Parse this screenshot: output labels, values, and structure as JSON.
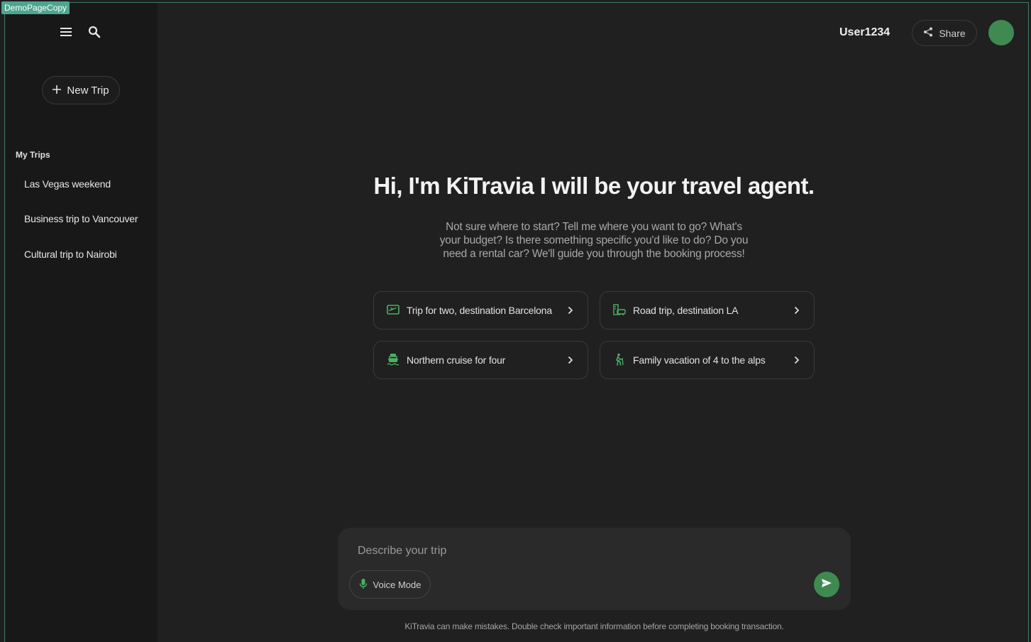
{
  "badge": "DemoPageCopy",
  "sidebar": {
    "new_trip_label": "New Trip",
    "section_title": "My Trips",
    "trips": [
      "Las Vegas weekend",
      "Business trip to Vancouver",
      "Cultural trip to Nairobi"
    ]
  },
  "header": {
    "username": "User1234",
    "share_label": "Share"
  },
  "main": {
    "headline": "Hi, I'm KiTravia I will be your travel agent.",
    "subtext": "Not sure where to start? Tell me where you want to go? What's your budget? Is there something specific you'd like to do? Do you need a rental car? We'll guide you through the booking process!",
    "suggestions": [
      {
        "label": "Trip for two, destination Barcelona",
        "icon": "flight-icon"
      },
      {
        "label": "Road trip, destination LA",
        "icon": "car-city-icon"
      },
      {
        "label": "Northern cruise for four",
        "icon": "ship-icon"
      },
      {
        "label": "Family vacation of 4 to the alps",
        "icon": "hiking-icon"
      }
    ]
  },
  "composer": {
    "placeholder": "Describe your trip",
    "voice_label": "Voice Mode"
  },
  "footer": {
    "disclaimer": "KiTravia can make mistakes. Double check important information before completing booking transaction."
  },
  "colors": {
    "accent": "#3f8a51",
    "icon_green": "#4caf66",
    "background": "#202020",
    "sidebar": "#181818"
  }
}
